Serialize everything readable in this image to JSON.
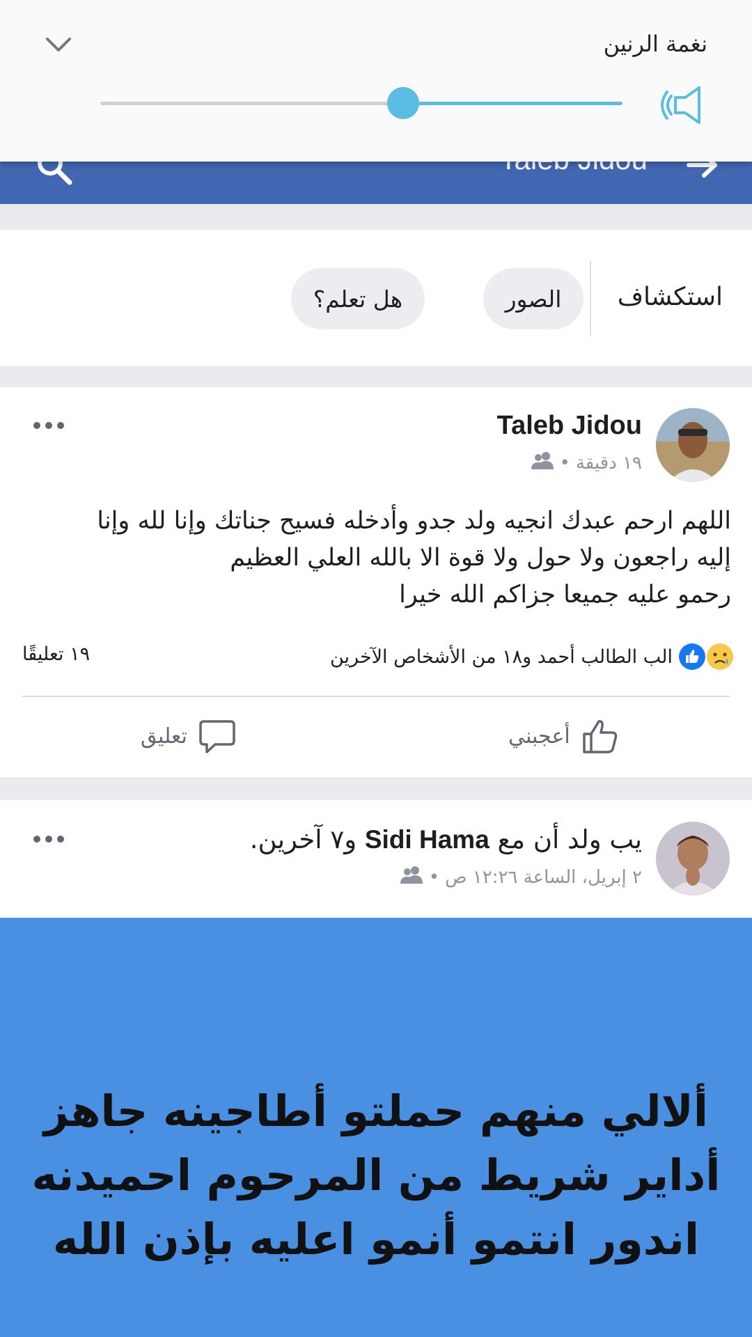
{
  "header": {
    "title": "Taleb Jidou"
  },
  "volume_panel": {
    "label": "نغمة الرنين",
    "level_fraction": 0.58,
    "accent_color": "#5bbde3"
  },
  "explore": {
    "label": "استكشاف",
    "chips": [
      "الصور",
      "هل تعلم؟"
    ]
  },
  "post1": {
    "author": "Taleb Jidou",
    "time": "١٩ دقيقة",
    "body_lines": [
      "اللهم ارحم عبدك انجيه ولد جدو وأدخله فسيح جناتك وإنا لله وإنا",
      "إليه راجعون ولا حول ولا قوة الا بالله العلي العظيم",
      "رحمو عليه جميعا جزاكم الله خيرا"
    ],
    "reactions_text": "الب الطالب أحمد و١٨ من الأشخاص الآخرين",
    "comments_count": "١٩ تعليقًا",
    "like_label": "أعجبني",
    "comment_label": "تعليق"
  },
  "post2": {
    "title_prefix": "يب ولد أن مع",
    "title_name": "Sidi Hama",
    "title_suffix": "و٧ آخرين.",
    "time": "٢ إبريل، الساعة ١٢:٢٦ ص",
    "bg_color": "#4a90e2",
    "bg_lines": [
      "ألالي منهم حملتو أطاجينه جاهز",
      "أداير شريط من المرحوم احميدنه",
      "اندور انتمو أنمو اعليه بإذن الله"
    ]
  },
  "brand_color": "#4267b2"
}
